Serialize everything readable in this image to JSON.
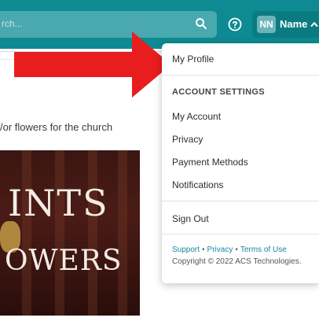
{
  "search": {
    "placeholder": "rch..."
  },
  "header": {
    "help_icon": "help-circle-icon",
    "user": {
      "initials": "NN",
      "name": "Name"
    }
  },
  "content": {
    "snippet": "/or flowers for the church",
    "hero_line1": "INTS",
    "hero_line2": "OWERS"
  },
  "menu": {
    "my_profile": "My Profile",
    "section_title": "ACCOUNT SETTINGS",
    "items": [
      "My Account",
      "Privacy",
      "Payment Methods",
      "Notifications"
    ],
    "sign_out": "Sign Out",
    "footer_links": [
      "Support",
      "Privacy",
      "Terms of Use"
    ],
    "copyright": "Copyright © 2022 ACS Technologies."
  },
  "colors": {
    "header": "#0e8a92",
    "link": "#1a86a0",
    "arrow": "#e81e1e"
  }
}
